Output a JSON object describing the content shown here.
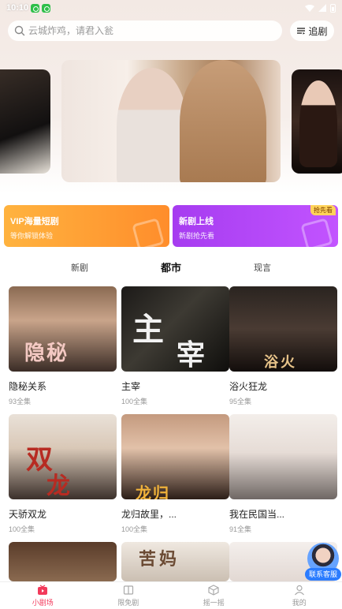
{
  "status_bar": {
    "time": "10:10"
  },
  "search": {
    "placeholder": "云城炸鸡，请君入瓮"
  },
  "header": {
    "follow_label": "追剧"
  },
  "promos": {
    "vip": {
      "title": "VIP海量短剧",
      "subtitle": "等你解锁体验"
    },
    "new": {
      "title": "新剧上线",
      "subtitle": "新剧抢先看",
      "badge": "抢先看"
    }
  },
  "tabs": [
    {
      "label": "新剧"
    },
    {
      "label": "都市"
    },
    {
      "label": "现言"
    }
  ],
  "dramas": [
    {
      "title": "隐秘关系",
      "episodes": "93全集"
    },
    {
      "title": "主宰",
      "episodes": "100全集"
    },
    {
      "title": "浴火狂龙",
      "episodes": "95全集"
    },
    {
      "title": "天骄双龙",
      "episodes": "100全集"
    },
    {
      "title": "龙归故里，...",
      "episodes": "100全集"
    },
    {
      "title": "我在民国当...",
      "episodes": "91全集"
    }
  ],
  "service": {
    "label": "联系客服"
  },
  "bottom_nav": [
    {
      "label": "小剧场"
    },
    {
      "label": "限免剧"
    },
    {
      "label": "摇一摇"
    },
    {
      "label": "我的"
    }
  ],
  "colors": {
    "accent": "#f23a5b",
    "vip": "#ff9a30",
    "new": "#b347f8",
    "service": "#2b7cff"
  }
}
